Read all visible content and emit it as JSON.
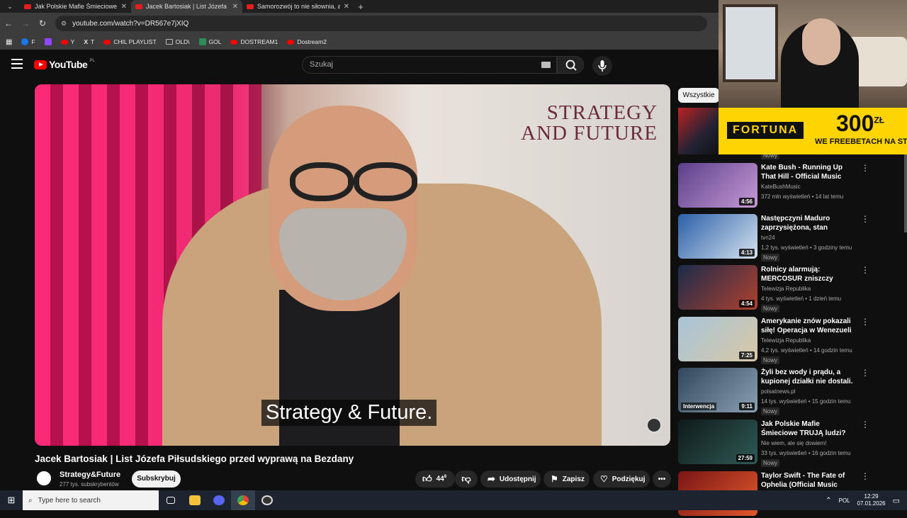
{
  "browser": {
    "tabs": [
      {
        "title": "Jak Polskie Mafie Śmieciowe TR",
        "active": false
      },
      {
        "title": "Jacek Bartosiak | List Józefa Piłs",
        "active": true
      },
      {
        "title": "Samorozwój to nie siłownia, a w",
        "active": false
      }
    ],
    "url": "youtube.com/watch?v=DR567e7jXIQ",
    "bookmarks": [
      {
        "label": "F",
        "icon": "facebook-icon",
        "color": "#1877f2"
      },
      {
        "label": "",
        "icon": "twitch-icon",
        "color": "#9146ff"
      },
      {
        "label": "Y",
        "icon": "youtube-icon",
        "color": "#ff0000"
      },
      {
        "label": "T",
        "icon": "x-icon",
        "color": "#ffffff"
      },
      {
        "label": "CHIL PLAYLIST",
        "icon": "youtube-icon",
        "color": "#ff0000"
      },
      {
        "label": "OLD\\",
        "icon": "folder-icon",
        "color": "#bbbbbb"
      },
      {
        "label": "GOL",
        "icon": "gol-icon",
        "color": "#2e8b57"
      },
      {
        "label": "DOSTREAM1",
        "icon": "youtube-icon",
        "color": "#ff0000"
      },
      {
        "label": "Dostream2",
        "icon": "youtube-icon",
        "color": "#ff0000"
      }
    ]
  },
  "youtube": {
    "logo_text": "YouTube",
    "logo_country": "PL",
    "search_placeholder": "Szukaj"
  },
  "video": {
    "brand_line1": "STRATEGY",
    "brand_line2": "AND FUTURE",
    "caption": "Strategy & Future.",
    "title": "Jacek Bartosiak | List Józefa Piłsudskiego przed wyprawą na Bezdany",
    "channel": "Strategy&Future",
    "subscribers": "277 tys. subskrybentów",
    "subscribe_label": "Subskrybuj",
    "likes": "44",
    "likes_sup": "8",
    "share_label": "Udostępnij",
    "save_label": "Zapisz",
    "thanks_label": "Podziękuj"
  },
  "sidebar": {
    "chip": "Wszystkie",
    "first_new": "Nowy",
    "items": [
      {
        "title": "Kate Bush - Running Up That Hill - Official Music Video",
        "channel": "KateBushMusic",
        "meta": "372 mln wyświetleń • 14 lat temu",
        "duration": "4:56",
        "new": "",
        "colors": [
          "#5b3f8a",
          "#c79ad6"
        ]
      },
      {
        "title": "Następczyni Maduro zaprzysiężona, stan wyjątkow...",
        "channel": "tvn24",
        "meta": "1,2 tys. wyświetleń • 3 godziny temu",
        "duration": "4:13",
        "new": "Nowy",
        "colors": [
          "#2a5fa8",
          "#d6e2ef"
        ]
      },
      {
        "title": "Rolnicy alarmują: MERCOSUR zniszczy lokalne rolnictwo",
        "channel": "Telewizja Republika",
        "meta": "4 tys. wyświetleń • 1 dzień temu",
        "duration": "4:54",
        "new": "Nowy",
        "colors": [
          "#1b2b4b",
          "#b0412e"
        ]
      },
      {
        "title": "Amerykanie znów pokazali siłę! Operacja w Wenezueli",
        "channel": "Telewizja Republika",
        "meta": "4,2 tys. wyświetleń • 14 godzin temu",
        "duration": "7:25",
        "new": "Nowy",
        "colors": [
          "#a8c4d8",
          "#d9c8a6"
        ]
      },
      {
        "title": "Żyli bez wody i prądu, a kupionej działki nie dostali. ...",
        "channel": "polsatnews.pl",
        "meta": "14 tys. wyświetleń • 15 godzin temu",
        "duration": "9:11",
        "new": "Nowy",
        "badge": "Interwencja",
        "colors": [
          "#33475a",
          "#8aa0b3"
        ]
      },
      {
        "title": "Jak Polskie Mafie Śmieciowe TRUJĄ ludzi? Cz. 2",
        "channel": "Nie wiem, ale się dowiem!",
        "meta": "33 tys. wyświetleń • 16 godzin temu",
        "duration": "27:59",
        "new": "Nowy",
        "colors": [
          "#0e1a1a",
          "#2f5a55"
        ]
      },
      {
        "title": "Taylor Swift - The Fate of Ophelia (Official Music Video)",
        "channel": "",
        "meta": "",
        "duration": "",
        "new": "",
        "colors": [
          "#7a1515",
          "#e0582b"
        ]
      }
    ]
  },
  "ad": {
    "brand": "FORTUNA",
    "amount": "300",
    "currency": "ZŁ",
    "tagline": "WE FREEBETACH NA START"
  },
  "taskbar": {
    "search_placeholder": "Type here to search",
    "language": "POL",
    "time": "12:29",
    "date": "07.01.2026"
  }
}
